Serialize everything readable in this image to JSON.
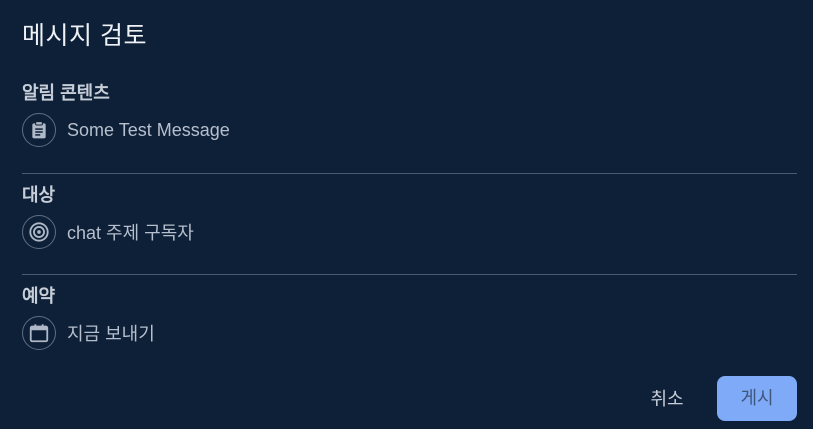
{
  "dialog": {
    "title": "메시지 검토"
  },
  "sections": {
    "content": {
      "label": "알림 콘텐츠",
      "value": "Some Test Message",
      "icon": "clipboard-icon"
    },
    "target": {
      "label": "대상",
      "value": "chat 주제 구독자",
      "icon": "target-icon"
    },
    "schedule": {
      "label": "예약",
      "value": "지금 보내기",
      "icon": "calendar-icon"
    }
  },
  "actions": {
    "cancel_label": "취소",
    "post_label": "게시"
  },
  "colors": {
    "background": "#0e2037",
    "primary_button": "#7eaaf7",
    "divider": "#4a5a70"
  }
}
